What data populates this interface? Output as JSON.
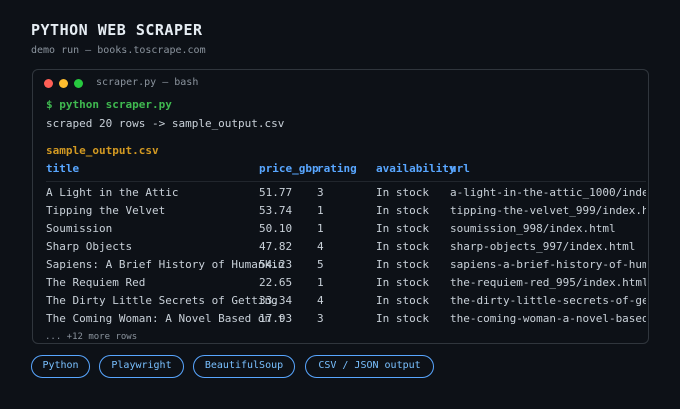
{
  "header": {
    "title": "PYTHON WEB SCRAPER",
    "subtitle": "demo run — books.toscrape.com"
  },
  "terminal": {
    "window_title": "scraper.py — bash",
    "command": "$ python scraper.py",
    "output": "scraped 20 rows -> sample_output.csv",
    "file_label": "sample_output.csv",
    "columns": [
      "title",
      "price_gbp",
      "rating",
      "availability",
      "url"
    ],
    "rows": [
      [
        "A Light in the Attic",
        "51.77",
        "3",
        "In stock",
        "a-light-in-the-attic_1000/inde"
      ],
      [
        "Tipping the Velvet",
        "53.74",
        "1",
        "In stock",
        "tipping-the-velvet_999/index.h"
      ],
      [
        "Soumission",
        "50.10",
        "1",
        "In stock",
        "soumission_998/index.html"
      ],
      [
        "Sharp Objects",
        "47.82",
        "4",
        "In stock",
        "sharp-objects_997/index.html"
      ],
      [
        "Sapiens: A Brief History of Humankin",
        "54.23",
        "5",
        "In stock",
        "sapiens-a-brief-history-of-hum"
      ],
      [
        "The Requiem Red",
        "22.65",
        "1",
        "In stock",
        "the-requiem-red_995/index.html"
      ],
      [
        "The Dirty Little Secrets of Getting",
        "33.34",
        "4",
        "In stock",
        "the-dirty-little-secrets-of-ge"
      ],
      [
        "The Coming Woman: A Novel Based on t",
        "17.93",
        "3",
        "In stock",
        "the-coming-woman-a-novel-based"
      ]
    ],
    "more_rows": "... +12 more rows"
  },
  "tags": [
    "Python",
    "Playwright",
    "BeautifulSoup",
    "CSV / JSON output"
  ],
  "colors": {
    "background": "#0d1117",
    "accent": "#58a6ff",
    "command": "#3fb950",
    "file_label": "#d29922"
  }
}
